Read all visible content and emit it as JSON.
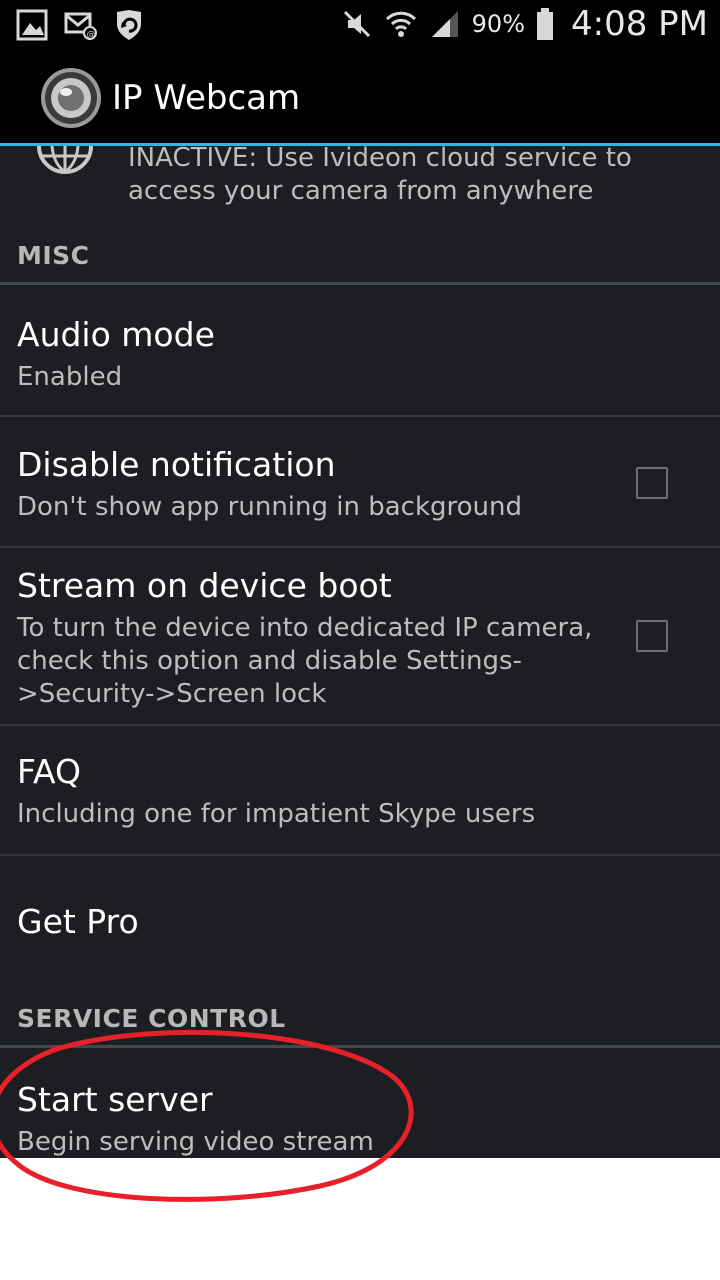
{
  "status_bar": {
    "left_icons": [
      "gallery-icon",
      "email-icon",
      "shield-sync-icon"
    ],
    "right_icons": [
      "mute-icon",
      "wifi-icon",
      "signal-icon",
      "battery-icon"
    ],
    "battery_percent": "90%",
    "time": "4:08 PM"
  },
  "action_bar": {
    "title": "IP Webcam",
    "accent_color": "#33b5e5"
  },
  "ivideon": {
    "summary_line1": "INACTIVE: Use Ivideon cloud service to",
    "summary_line2": "access your camera from anywhere"
  },
  "sections": {
    "misc": "MISC",
    "service_control": "SERVICE CONTROL"
  },
  "items": {
    "audio_mode": {
      "title": "Audio mode",
      "summary": "Enabled"
    },
    "disable_notification": {
      "title": "Disable notification",
      "summary": "Don't show app running in background",
      "checked": false
    },
    "stream_on_boot": {
      "title": "Stream on device boot",
      "summary_line1": "To turn the device into dedicated IP camera,",
      "summary_line2": "check this option and disable Settings-",
      "summary_line3": ">Security->Screen lock",
      "checked": false
    },
    "faq": {
      "title": "FAQ",
      "summary": "Including one for impatient Skype users"
    },
    "get_pro": {
      "title": "Get Pro"
    },
    "start_server": {
      "title": "Start server",
      "summary": "Begin serving video stream"
    }
  },
  "annotation": {
    "color": "#e8202a",
    "target": "start-server"
  }
}
